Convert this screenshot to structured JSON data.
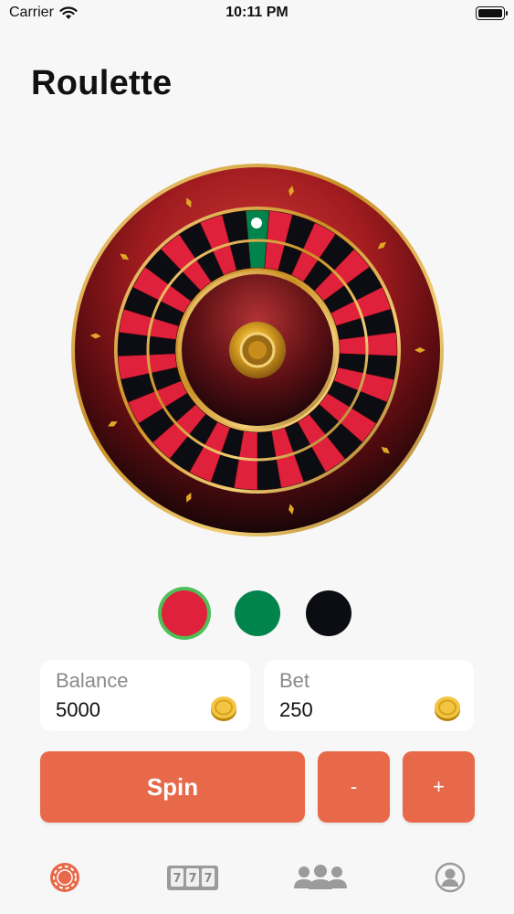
{
  "status_bar": {
    "carrier": "Carrier",
    "time": "10:11 PM"
  },
  "page": {
    "title": "Roulette"
  },
  "colors": {
    "accent": "#e8694a",
    "red": "#e0213b",
    "green": "#00844b",
    "black": "#0b0d12",
    "selected_ring": "#4fbf58",
    "gold": "#e0a825"
  },
  "color_options": [
    {
      "id": "red",
      "color": "#e0213b",
      "selected": true
    },
    {
      "id": "green",
      "color": "#00844b",
      "selected": false
    },
    {
      "id": "black",
      "color": "#0b0d12",
      "selected": false
    }
  ],
  "balance": {
    "label": "Balance",
    "value": "5000",
    "icon": "coin-icon"
  },
  "bet": {
    "label": "Bet",
    "value": "250",
    "icon": "coin-icon"
  },
  "actions": {
    "spin_label": "Spin",
    "minus_label": "-",
    "plus_label": "+"
  },
  "tabs": [
    {
      "id": "roulette",
      "icon": "roulette-chip-icon",
      "active": true
    },
    {
      "id": "slots",
      "icon": "slot-machine-icon",
      "active": false
    },
    {
      "id": "players",
      "icon": "group-icon",
      "active": false
    },
    {
      "id": "profile",
      "icon": "profile-icon",
      "active": false
    }
  ],
  "slots_icon_digits": [
    "7",
    "7",
    "7"
  ]
}
